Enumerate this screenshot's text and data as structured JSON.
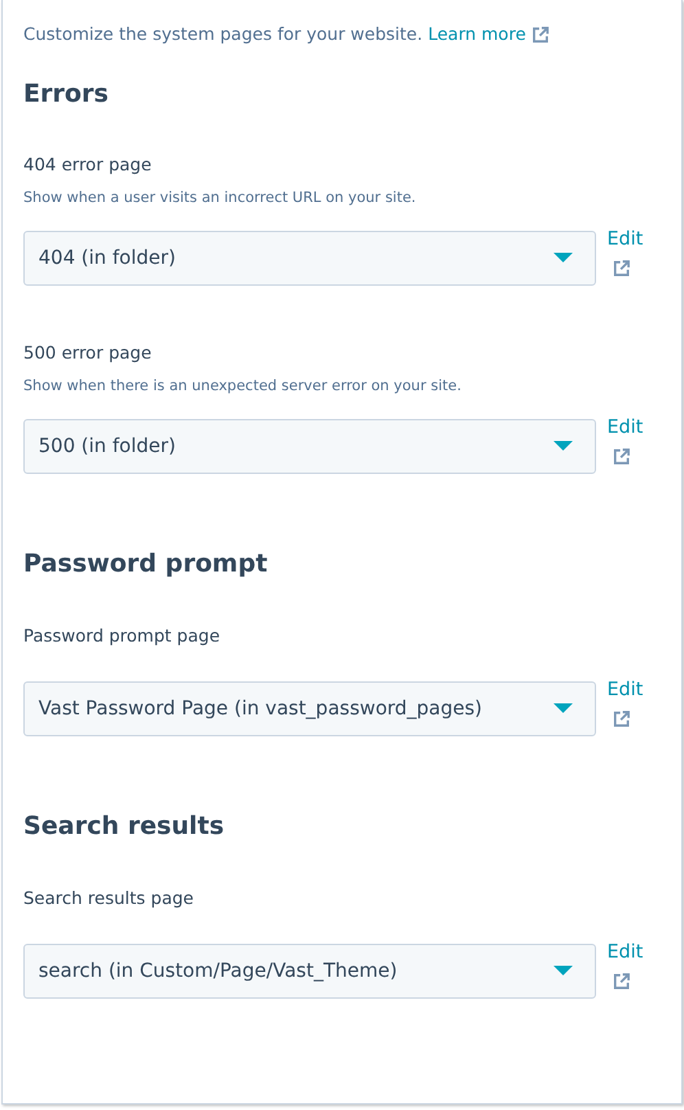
{
  "intro": {
    "text": "Customize the system pages for your website.",
    "link": "Learn more"
  },
  "sections": [
    {
      "title": "Errors",
      "fields": [
        {
          "label": "404 error page",
          "description": "Show when a user visits an incorrect URL on your site.",
          "value": "404 (in folder)",
          "edit": "Edit"
        },
        {
          "label": "500 error page",
          "description": "Show when there is an unexpected server error on your site.",
          "value": "500 (in folder)",
          "edit": "Edit"
        }
      ]
    },
    {
      "title": "Password prompt",
      "fields": [
        {
          "label": "Password prompt page",
          "value": "Vast Password Page (in vast_password_pages)",
          "edit": "Edit"
        }
      ]
    },
    {
      "title": "Search results",
      "fields": [
        {
          "label": "Search results page",
          "value": "search (in Custom/Page/Vast_Theme)",
          "edit": "Edit"
        }
      ]
    }
  ]
}
